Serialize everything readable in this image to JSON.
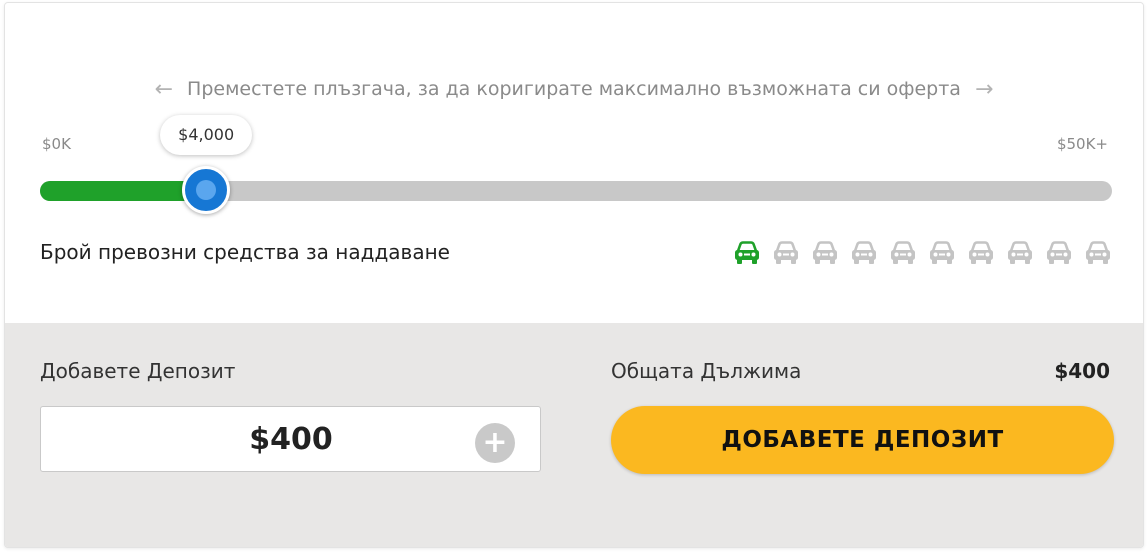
{
  "slider": {
    "hint": "Преместете плъзгача, за да коригирате максимално възможната си оферта",
    "min_label": "$0K",
    "max_label": "$50K+",
    "current_label": "$4,000",
    "min_value": 0,
    "max_value": 50000,
    "current_value": 4000,
    "fill_color": "#1fa12a",
    "thumb_color": "#1677d4"
  },
  "vehicles": {
    "label": "Брой превозни средства за наддаване",
    "total": 10,
    "active": 1,
    "active_color": "#1fa12a",
    "inactive_color": "#c4c4c4",
    "icon": "car-icon"
  },
  "deposit": {
    "label": "Добавете Депозит",
    "value": "$400",
    "plus_icon": "plus-circle-icon"
  },
  "total": {
    "label": "Общата Дължима",
    "value": "$400"
  },
  "action": {
    "button_label": "ДОБАВЕТЕ ДЕПОЗИТ",
    "color": "#fbb820"
  }
}
